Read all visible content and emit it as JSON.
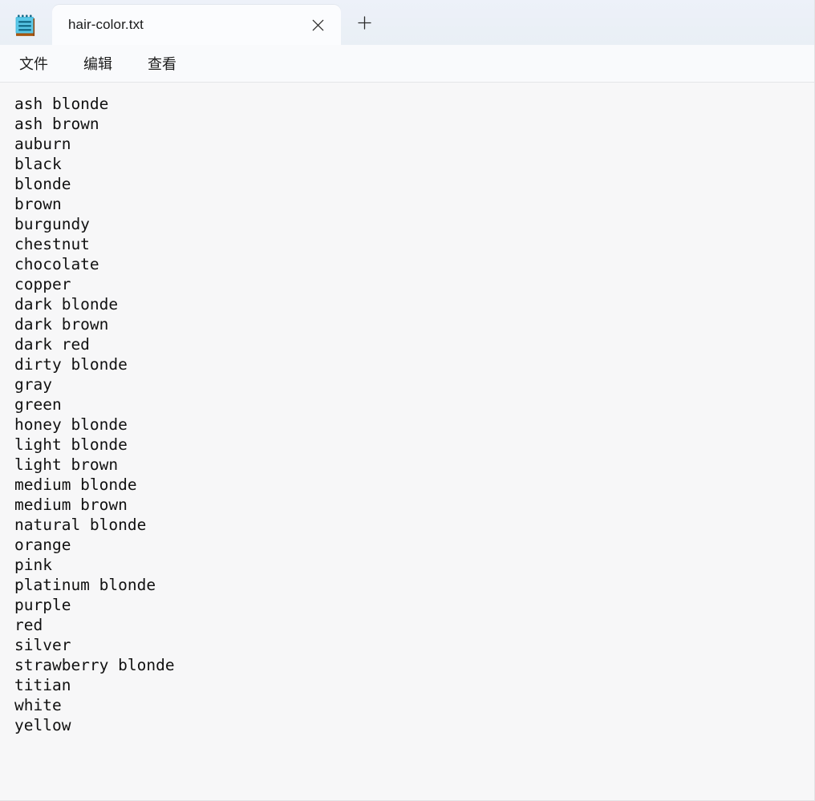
{
  "window": {
    "app_icon": "notepad-icon",
    "accent_color": "#4cc2e4",
    "titlebar_color": "#edf1f9",
    "editor_bg": "#f7f7f8"
  },
  "tabs": [
    {
      "title": "hair-color.txt",
      "close_icon": "close-icon",
      "active": true
    }
  ],
  "new_tab": {
    "icon": "plus-icon",
    "label": "+"
  },
  "menu": {
    "items": [
      {
        "label": "文件",
        "name": "file"
      },
      {
        "label": "编辑",
        "name": "edit"
      },
      {
        "label": "查看",
        "name": "view"
      }
    ]
  },
  "document": {
    "filename": "hair-color.txt",
    "lines": [
      "ash blonde",
      "ash brown",
      "auburn",
      "black",
      "blonde",
      "brown",
      "burgundy",
      "chestnut",
      "chocolate",
      "copper",
      "dark blonde",
      "dark brown",
      "dark red",
      "dirty blonde",
      "gray",
      "green",
      "honey blonde",
      "light blonde",
      "light brown",
      "medium blonde",
      "medium brown",
      "natural blonde",
      "orange",
      "pink",
      "platinum blonde",
      "purple",
      "red",
      "silver",
      "strawberry blonde",
      "titian",
      "white",
      "yellow"
    ]
  }
}
